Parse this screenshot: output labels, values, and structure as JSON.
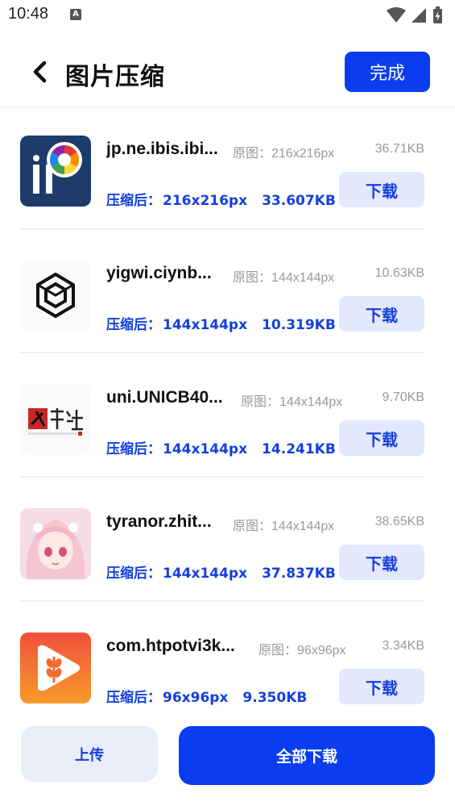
{
  "status_bar": {
    "time": "10:48",
    "notif_icon": "a-letter-icon",
    "icons": [
      "wifi-icon",
      "signal-icon",
      "battery-charging-icon"
    ]
  },
  "header": {
    "back_icon": "chevron-left-icon",
    "title": "图片压缩",
    "done_label": "完成"
  },
  "labels": {
    "original_prefix": "原图：",
    "compressed_prefix": "压缩后：",
    "download": "下载"
  },
  "items": [
    {
      "name": "jp.ne.ibis.ibi...",
      "icon": "ibis-paint-icon",
      "original_dims": "216x216px",
      "original_size": "36.71KB",
      "compressed_dims": "216x216px",
      "compressed_size": "33.607KB"
    },
    {
      "name": "yigwi.ciynb...",
      "icon": "cube-logo-icon",
      "original_dims": "144x144px",
      "original_size": "10.63KB",
      "compressed_dims": "144x144px",
      "compressed_size": "10.319KB"
    },
    {
      "name": "uni.UNICB40...",
      "icon": "fenxiangshe-logo-icon",
      "original_dims": "144x144px",
      "original_size": "9.70KB",
      "compressed_dims": "144x144px",
      "compressed_size": "14.241KB"
    },
    {
      "name": "tyranor.zhit...",
      "icon": "anime-girl-avatar-icon",
      "original_dims": "144x144px",
      "original_size": "38.65KB",
      "compressed_dims": "144x144px",
      "compressed_size": "37.837KB"
    },
    {
      "name": "com.htpotvi3k...",
      "icon": "wheat-play-icon",
      "original_dims": "96x96px",
      "original_size": "3.34KB",
      "compressed_dims": "96x96px",
      "compressed_size": "9.350KB"
    }
  ],
  "footer": {
    "upload_label": "上传",
    "download_all_label": "全部下载"
  },
  "colors": {
    "primary": "#0a3df0",
    "accent_text": "#1440e0",
    "secondary_button_bg": "#e3e8fc"
  }
}
